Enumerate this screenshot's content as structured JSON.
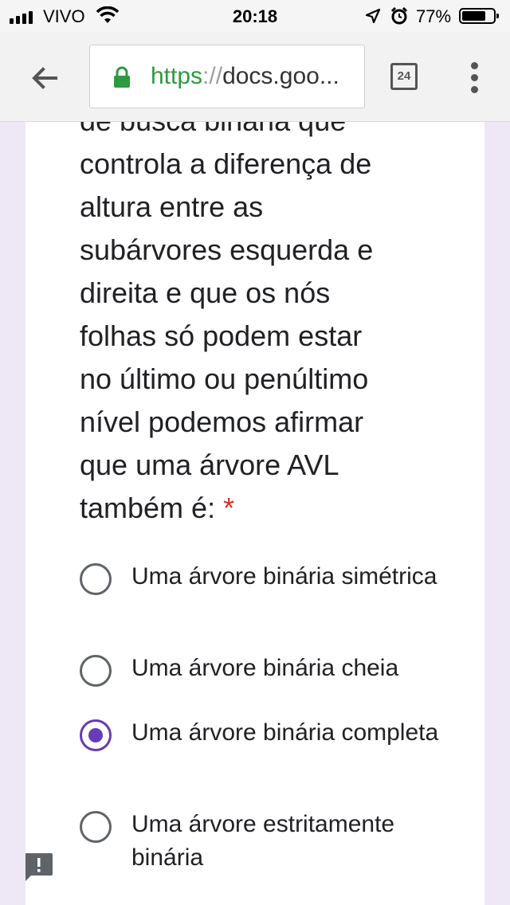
{
  "status_bar": {
    "carrier": "VIVO",
    "time": "20:18",
    "battery_percent": "77%",
    "battery_level": 0.77,
    "icons": [
      "signal-icon",
      "wifi-icon",
      "location-arrow-icon",
      "alarm-icon",
      "battery-icon"
    ]
  },
  "browser": {
    "back_icon": "arrow-left-icon",
    "lock_icon": "lock-icon",
    "url_scheme": "https",
    "url_separator": "://",
    "url_host": "docs.goo...",
    "tab_count": "24",
    "menu_icon": "more-vert-icon",
    "secure_color": "#2e9a3f"
  },
  "form": {
    "question_lines": [
      "de busca binária que",
      "controla a diferença de",
      "altura entre as",
      "subárvores esquerda e",
      "direita e que os nós",
      "folhas só podem estar",
      "no último ou penúltimo",
      "nível podemos afirmar",
      "que uma árvore AVL",
      "também é:"
    ],
    "required_mark": "*",
    "options": [
      {
        "label": "Uma árvore binária simétrica",
        "selected": false
      },
      {
        "label": "Uma árvore binária cheia",
        "selected": false
      },
      {
        "label": "Uma árvore binária completa",
        "selected": true
      },
      {
        "label": "Uma árvore estritamente binária",
        "selected": false
      }
    ],
    "accent_color": "#673ab7",
    "required_color": "#d93025"
  },
  "feedback": {
    "icon": "report-feedback-icon"
  }
}
